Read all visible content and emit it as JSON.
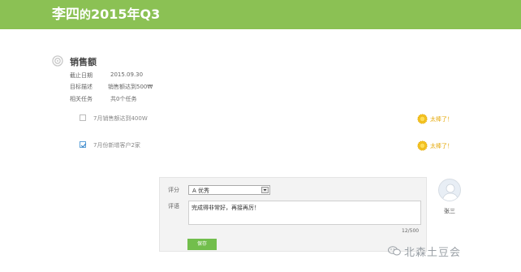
{
  "header": {
    "name": "李四",
    "of": "的",
    "period": "2015年Q3",
    "color": "#8bc154"
  },
  "objective": {
    "icon": "target-icon",
    "title": "销售额",
    "rows": [
      {
        "label": "截止日期",
        "value": "2015.09.30"
      },
      {
        "label": "目标描述",
        "value": "销售额达到500₩"
      },
      {
        "label": "相关任务",
        "value": "共0个任务"
      }
    ]
  },
  "tasks": [
    {
      "text": "7月销售额达到400W",
      "checked": false,
      "badge": "太棒了！"
    },
    {
      "text": "7月份新增客户2家",
      "checked": true,
      "badge": "太棒了！"
    }
  ],
  "review": {
    "rating_label": "评分",
    "rating_value": "A 优秀",
    "comment_label": "评语",
    "comment_value": "完成得非常好，再接再厉！",
    "counter": "12/500",
    "save_label": "保存"
  },
  "reviewer": {
    "name": "张三"
  },
  "watermark": {
    "text": "北森土豆会",
    "icon": "wechat-icon"
  }
}
